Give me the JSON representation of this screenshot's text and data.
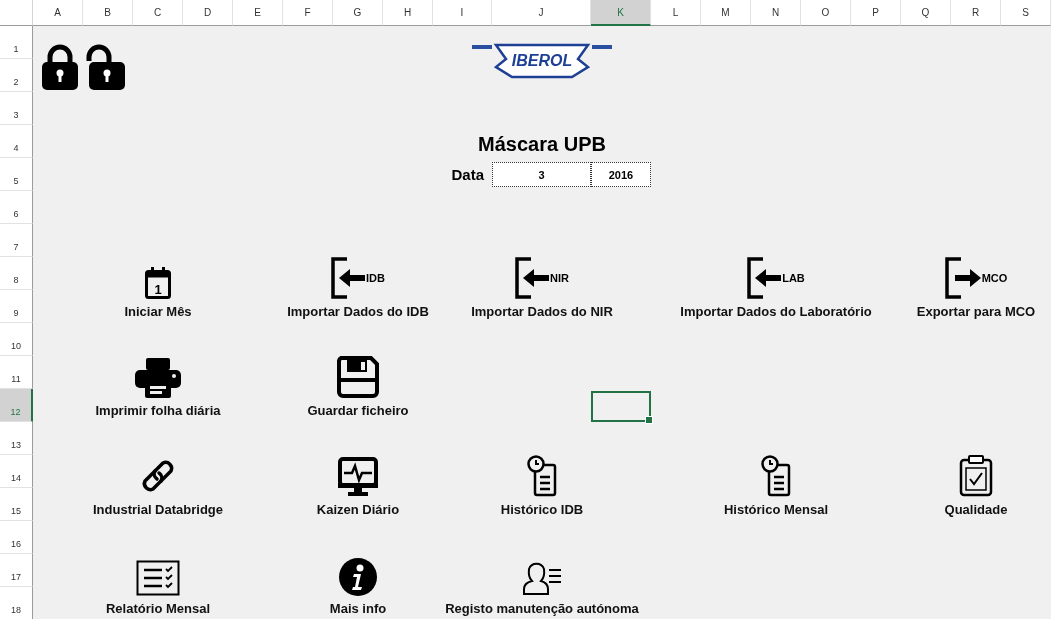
{
  "sheet": {
    "columns": [
      {
        "label": "A",
        "selected": false
      },
      {
        "label": "B",
        "selected": false
      },
      {
        "label": "C",
        "selected": false
      },
      {
        "label": "D",
        "selected": false
      },
      {
        "label": "E",
        "selected": false
      },
      {
        "label": "F",
        "selected": false
      },
      {
        "label": "G",
        "selected": false
      },
      {
        "label": "H",
        "selected": false
      },
      {
        "label": "I",
        "selected": false
      },
      {
        "label": "J",
        "selected": false
      },
      {
        "label": "K",
        "selected": true
      },
      {
        "label": "L",
        "selected": false
      },
      {
        "label": "M",
        "selected": false
      },
      {
        "label": "N",
        "selected": false
      },
      {
        "label": "O",
        "selected": false
      },
      {
        "label": "P",
        "selected": false
      },
      {
        "label": "Q",
        "selected": false
      },
      {
        "label": "R",
        "selected": false
      },
      {
        "label": "S",
        "selected": false
      }
    ],
    "rows": [
      {
        "label": "1",
        "selected": false
      },
      {
        "label": "2",
        "selected": false
      },
      {
        "label": "3",
        "selected": false
      },
      {
        "label": "4",
        "selected": false
      },
      {
        "label": "5",
        "selected": false
      },
      {
        "label": "6",
        "selected": false
      },
      {
        "label": "7",
        "selected": false
      },
      {
        "label": "8",
        "selected": false
      },
      {
        "label": "9",
        "selected": false
      },
      {
        "label": "10",
        "selected": false
      },
      {
        "label": "11",
        "selected": false
      },
      {
        "label": "12",
        "selected": true
      },
      {
        "label": "13",
        "selected": false
      },
      {
        "label": "14",
        "selected": false
      },
      {
        "label": "15",
        "selected": false
      },
      {
        "label": "16",
        "selected": false
      },
      {
        "label": "17",
        "selected": false
      },
      {
        "label": "18",
        "selected": false
      }
    ]
  },
  "logo": {
    "text": "IBEROL"
  },
  "title": "Máscara UPB",
  "date": {
    "label": "Data",
    "month": "3",
    "year": "2016"
  },
  "button_rows": [
    {
      "buttons": [
        {
          "label": "Iniciar Mês",
          "icon_text": "1"
        },
        {
          "label": "Importar Dados do IDB",
          "tag": "IDB"
        },
        {
          "label": "Importar Dados do NIR",
          "tag": "NIR"
        },
        {
          "label": "Importar Dados do Laboratório",
          "tag": "LAB"
        },
        {
          "label": "Exportar para MCO",
          "tag": "MCO"
        }
      ]
    },
    {
      "buttons": [
        {
          "label": "Imprimir folha diária"
        },
        {
          "label": "Guardar ficheiro"
        }
      ]
    },
    {
      "buttons": [
        {
          "label": "Industrial Databridge"
        },
        {
          "label": "Kaizen Diário"
        },
        {
          "label": "Histórico IDB"
        },
        {
          "label": "Histórico Mensal"
        },
        {
          "label": "Qualidade"
        }
      ]
    },
    {
      "buttons": [
        {
          "label": "Relatório Mensal"
        },
        {
          "label": "Mais info"
        },
        {
          "label": "Registo manutenção autónoma"
        }
      ]
    }
  ]
}
